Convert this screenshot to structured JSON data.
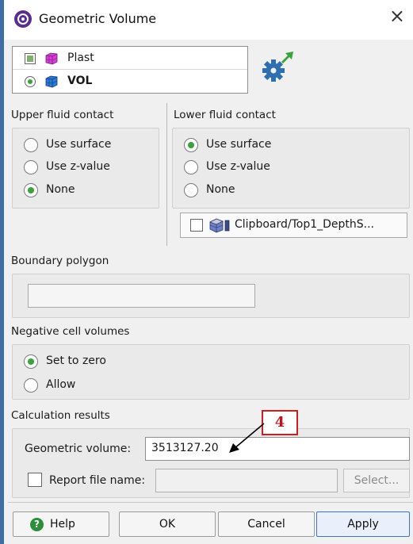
{
  "window": {
    "title": "Geometric Volume",
    "close_glyph": "×",
    "icon": "app-logo-icon"
  },
  "object_list": {
    "items": [
      {
        "label": "Plast",
        "control": "checkbox",
        "checked": true,
        "icon": "grid-cube-icon",
        "icon_color": "#d63fd6"
      },
      {
        "label": "VOL",
        "control": "radio",
        "selected": true,
        "icon": "grid-cube-icon",
        "icon_color": "#2e7bd6"
      }
    ]
  },
  "run_button": {
    "icon": "gear-icon",
    "color": "#2e6fb0",
    "accent": "#3aa33a"
  },
  "upper_fluid_contact": {
    "title": "Upper fluid contact",
    "options": [
      {
        "label": "Use surface",
        "selected": false
      },
      {
        "label": "Use z-value",
        "selected": false
      },
      {
        "label": "None",
        "selected": true
      }
    ]
  },
  "lower_fluid_contact": {
    "title": "Lower fluid contact",
    "options": [
      {
        "label": "Use surface",
        "selected": true
      },
      {
        "label": "Use z-value",
        "selected": false
      },
      {
        "label": "None",
        "selected": false
      }
    ],
    "surface": {
      "label": "Clipboard/Top1_DepthS...",
      "checked": false,
      "icon": "surface-icon"
    }
  },
  "boundary_polygon": {
    "title": "Boundary polygon",
    "value": ""
  },
  "negative_cell_volumes": {
    "title": "Negative cell volumes",
    "options": [
      {
        "label": "Set to zero",
        "selected": true
      },
      {
        "label": "Allow",
        "selected": false
      }
    ]
  },
  "calculation_results": {
    "title": "Calculation results",
    "geometric_volume_label": "Geometric volume:",
    "geometric_volume_value": "3513127.20",
    "report_label": "Report file name:",
    "report_checked": false,
    "report_value": "",
    "select_label": "Select..."
  },
  "annotation": {
    "label": "4",
    "color": "#c0141c"
  },
  "buttons": {
    "help": "Help",
    "ok": "OK",
    "cancel": "Cancel",
    "apply": "Apply"
  }
}
